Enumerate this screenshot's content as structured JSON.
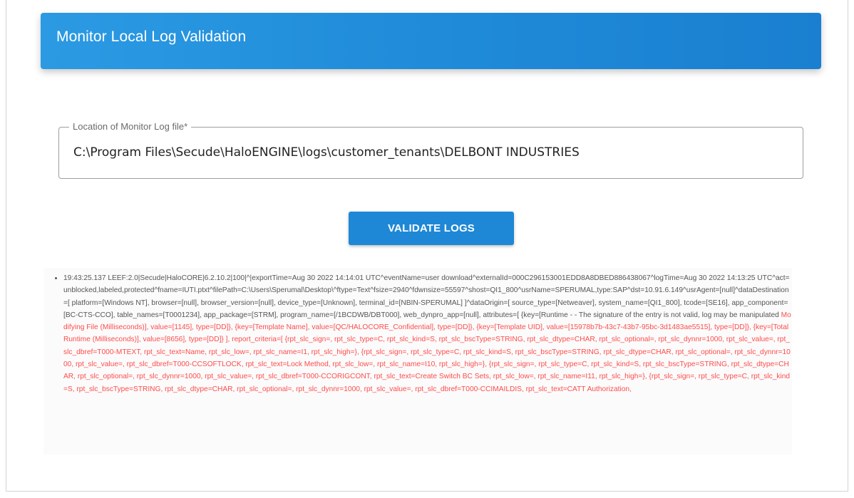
{
  "header": {
    "title": "Monitor Local Log Validation"
  },
  "log_file_field": {
    "label": "Location of Monitor Log file*",
    "value": "C:\\Program Files\\Secude\\HaloENGINE\\logs\\customer_tenants\\DELBONT INDUSTRIES"
  },
  "validate_button": {
    "label": "VALIDATE LOGS"
  },
  "log_output": {
    "entries": [
      {
        "normal_text": "19:43:25.137 LEEF:2.0|Secude|HaloCORE|6.2.10.2|100|^|exportTime=Aug 30 2022 14:14:01 UTC^eventName=user download^externalId=000C296153001EDD8A8DBED886438067^logTime=Aug 30 2022 14:13:25 UTC^act=unblocked,labeled,protected^fname=IUTI.ptxt^filePath=C:\\Users\\Sperumal\\Desktop\\^ftype=Text^fsize=2940^fdwnsize=55597^shost=QI1_800^usrName=SPERUMAL,type:SAP^dst=10.91.6.149^usrAgent=[null]^dataDestination=[ platform=[Windows NT], browser=[null], browser_version=[null], device_type=[Unknown], terminal_id=[NBIN-SPERUMAL] ]^dataOrigin=[ source_type=[Netweaver], system_name=[QI1_800], tcode=[SE16], app_component=[BC-CTS-CCO], table_names=[T0001234], app_package=[STRM], program_name=[/1BCDWB/DBT000], web_dynpro_app=[null], attributes=[ {key=[Runtime - - The signature of the entry is not valid, log may be manipulated ",
        "error_text": "Modifying File (Milliseconds)], value=[1145], type=[DD]}, {key=[Template Name], value=[QC/HALOCORE_Confidential], type=[DD]}, {key=[Template UID], value=[15978b7b-43c7-43b7-95bc-3d1483ae5515], type=[DD]}, {key=[Total Runtime (Milliseconds)], value=[8656], type=[DD]} ], report_criteria=[ {rpt_slc_sign=, rpt_slc_type=C, rpt_slc_kind=S, rpt_slc_bscType=STRING, rpt_slc_dtype=CHAR, rpt_slc_optional=, rpt_slc_dynnr=1000, rpt_slc_value=, rpt_slc_dbref=T000-MTEXT, rpt_slc_text=Name, rpt_slc_low=, rpt_slc_name=I1, rpt_slc_high=}, {rpt_slc_sign=, rpt_slc_type=C, rpt_slc_kind=S, rpt_slc_bscType=STRING, rpt_slc_dtype=CHAR, rpt_slc_optional=, rpt_slc_dynnr=1000, rpt_slc_value=, rpt_slc_dbref=T000-CCSOFTLOCK, rpt_slc_text=Lock Method, rpt_slc_low=, rpt_slc_name=I10, rpt_slc_high=}, {rpt_slc_sign=, rpt_slc_type=C, rpt_slc_kind=S, rpt_slc_bscType=STRING, rpt_slc_dtype=CHAR, rpt_slc_optional=, rpt_slc_dynnr=1000, rpt_slc_value=, rpt_slc_dbref=T000-CCORIGCONT, rpt_slc_text=Create Switch BC Sets, rpt_slc_low=, rpt_slc_name=I11, rpt_slc_high=}, {rpt_slc_sign=, rpt_slc_type=C, rpt_slc_kind=S, rpt_slc_bscType=STRING, rpt_slc_dtype=CHAR, rpt_slc_optional=, rpt_slc_dynnr=1000, rpt_slc_value=, rpt_slc_dbref=T000-CCIMAILDIS, rpt_slc_text=CATT Authorization,"
      }
    ]
  },
  "colors": {
    "header_gradient_start": "#2b9ae3",
    "header_gradient_end": "#1a7fd0",
    "button_bg": "#1e88d6",
    "log_error_text": "#ff4c4c",
    "log_normal_text": "#555555"
  }
}
